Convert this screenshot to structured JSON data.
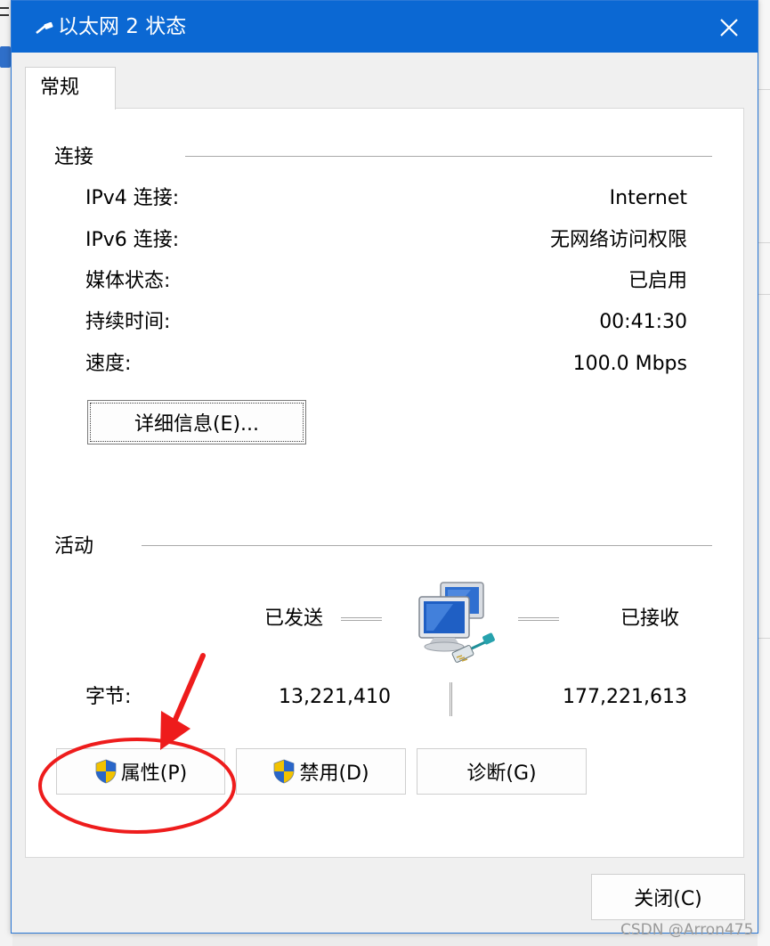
{
  "window": {
    "title": "以太网 2 状态",
    "tab": "常规"
  },
  "connection": {
    "section_title": "连接",
    "rows": [
      {
        "label": "IPv4 连接:",
        "value": "Internet"
      },
      {
        "label": "IPv6 连接:",
        "value": "无网络访问权限"
      },
      {
        "label": "媒体状态:",
        "value": "已启用"
      },
      {
        "label": "持续时间:",
        "value": "00:41:30"
      },
      {
        "label": "速度:",
        "value": "100.0 Mbps"
      }
    ],
    "details_button": "详细信息(E)..."
  },
  "activity": {
    "section_title": "活动",
    "sent_label": "已发送",
    "received_label": "已接收",
    "bytes_label": "字节:",
    "bytes_sent": "13,221,410",
    "bytes_received": "177,221,613"
  },
  "buttons": {
    "properties": "属性(P)",
    "disable": "禁用(D)",
    "diagnose": "诊断(G)",
    "close": "关闭(C)"
  },
  "watermark": "CSDN @Arron475",
  "colors": {
    "titlebar": "#0b68d3",
    "annotation_red": "#ee1c1c"
  }
}
